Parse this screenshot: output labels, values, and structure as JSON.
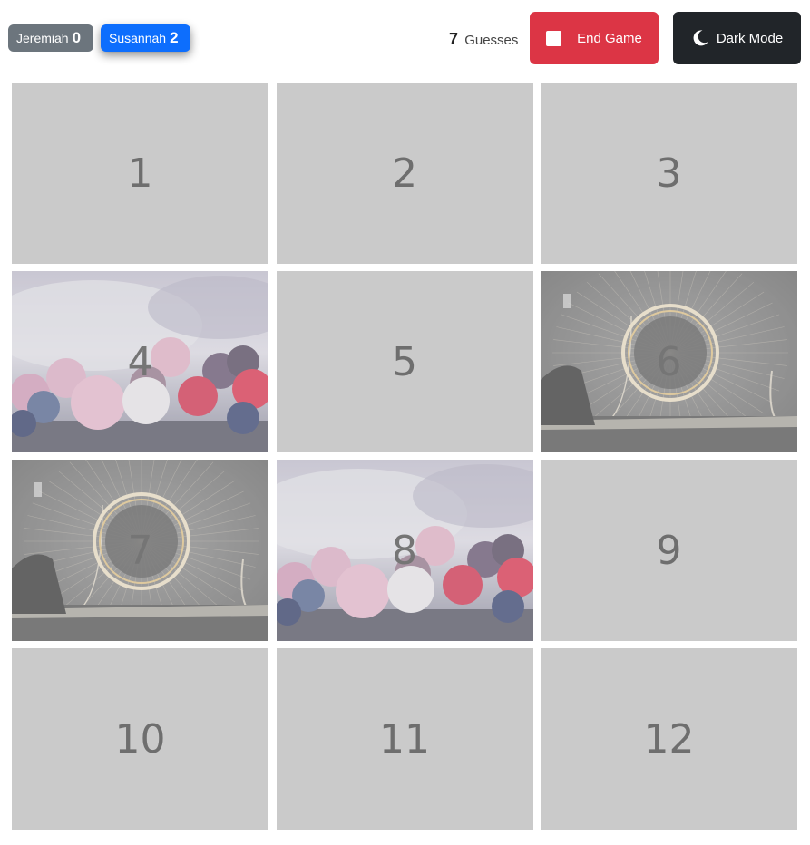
{
  "players": [
    {
      "name": "Jeremiah",
      "score": "0",
      "color": "#6c757d",
      "active": false
    },
    {
      "name": "Susannah",
      "score": "2",
      "color": "#0d6efd",
      "active": true
    }
  ],
  "guesses": {
    "count": "7",
    "label": "Guesses"
  },
  "buttons": {
    "end_game": {
      "label": "End Game",
      "icon": "stop-icon",
      "color": "#dc3545"
    },
    "dark_mode": {
      "label": "Dark Mode",
      "icon": "moon-icon",
      "color": "#212529"
    }
  },
  "cards": [
    {
      "label": "1",
      "state": "hidden"
    },
    {
      "label": "2",
      "state": "hidden"
    },
    {
      "label": "3",
      "state": "hidden"
    },
    {
      "label": "4",
      "state": "revealed",
      "image": "frozen-berries"
    },
    {
      "label": "5",
      "state": "hidden"
    },
    {
      "label": "6",
      "state": "revealed",
      "image": "steel-wool-sparks"
    },
    {
      "label": "7",
      "state": "revealed",
      "image": "steel-wool-sparks"
    },
    {
      "label": "8",
      "state": "revealed",
      "image": "frozen-berries"
    },
    {
      "label": "9",
      "state": "hidden"
    },
    {
      "label": "10",
      "state": "hidden"
    },
    {
      "label": "11",
      "state": "hidden"
    },
    {
      "label": "12",
      "state": "hidden"
    }
  ],
  "colors": {
    "card_back": "#cacaca",
    "number": "#6e6e6e"
  }
}
